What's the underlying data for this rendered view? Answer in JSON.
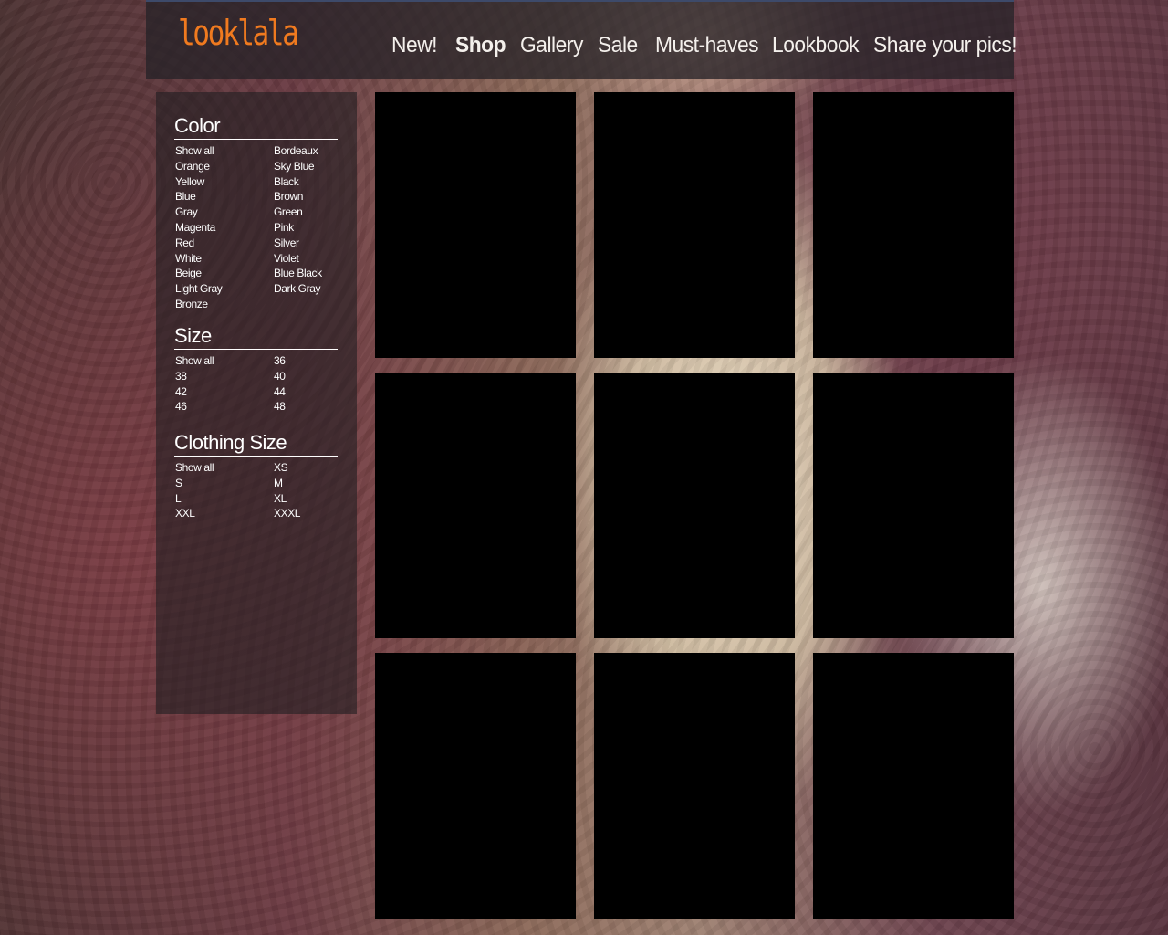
{
  "header": {
    "logo": "looklala",
    "nav": [
      {
        "label": "New!",
        "active": false
      },
      {
        "label": "Shop",
        "active": true
      },
      {
        "label": "Gallery",
        "active": false
      },
      {
        "label": "Sale",
        "active": false
      },
      {
        "label": "Must-haves",
        "active": false
      },
      {
        "label": "Lookbook",
        "active": false
      },
      {
        "label": "Share your pics!",
        "active": false
      }
    ]
  },
  "filters": {
    "color": {
      "title": "Color",
      "options": [
        "Show all",
        "Bordeaux",
        "Orange",
        "Sky Blue",
        "Yellow",
        "Black",
        "Blue",
        "Brown",
        "Gray",
        "Green",
        "Magenta",
        "Pink",
        "Red",
        "Silver",
        "White",
        "Violet",
        "Beige",
        "Blue Black",
        "Light Gray",
        "Dark Gray",
        "Bronze"
      ]
    },
    "size": {
      "title": "Size",
      "options": [
        "Show all",
        "36",
        "38",
        "40",
        "42",
        "44",
        "46",
        "48"
      ]
    },
    "clothing_size": {
      "title": "Clothing Size",
      "options": [
        "Show all",
        "XS",
        "S",
        "M",
        "L",
        "XL",
        "XXL",
        "XXXL"
      ]
    }
  },
  "products": {
    "count_tiles": 9
  },
  "colors": {
    "logo": "#f07a1f",
    "tile": "#000000"
  }
}
